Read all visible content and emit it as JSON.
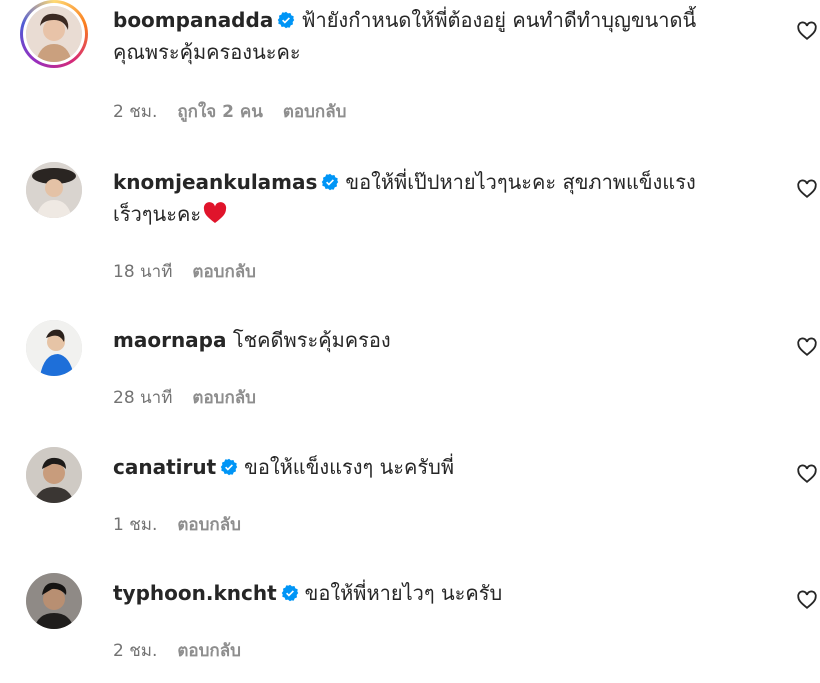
{
  "comments": [
    {
      "username": "boompanadda",
      "verified": true,
      "text_line1": "ฟ้ายังกำหนดให้พี่ต้องอยู่ คนทำดีทำบุญขนาดนี้",
      "text_line2": "คุณพระคุ้มครองนะคะ",
      "time": "2 ชม.",
      "likes": "ถูกใจ 2 คน",
      "reply": "ตอบกลับ"
    },
    {
      "username": "knomjeankulamas",
      "verified": true,
      "text_line1": "ขอให้พี่เป๊ปหายไวๆนะคะ สุขภาพแข็งแรง",
      "text_line2": "เร็วๆนะคะ",
      "emoji": "red-heart",
      "time": "18 นาที",
      "reply": "ตอบกลับ"
    },
    {
      "username": "maornapa",
      "verified": false,
      "text_line1": "โชคดีพระคุ้มครอง",
      "time": "28 นาที",
      "reply": "ตอบกลับ"
    },
    {
      "username": "canatirut",
      "verified": true,
      "text_line1": "ขอให้แข็งแรงๆ นะครับพี่",
      "time": "1 ชม.",
      "reply": "ตอบกลับ"
    },
    {
      "username": "typhoon.kncht",
      "verified": true,
      "text_line1": "ขอให้พี่หายไวๆ นะครับ",
      "time": "2 ชม.",
      "reply": "ตอบกลับ"
    }
  ],
  "icons": {
    "verified": "verified-badge-icon",
    "like": "heart-outline-icon"
  },
  "colors": {
    "verified": "#0095f6",
    "heart_emoji": "#e0142b",
    "meta_text": "#737373"
  }
}
